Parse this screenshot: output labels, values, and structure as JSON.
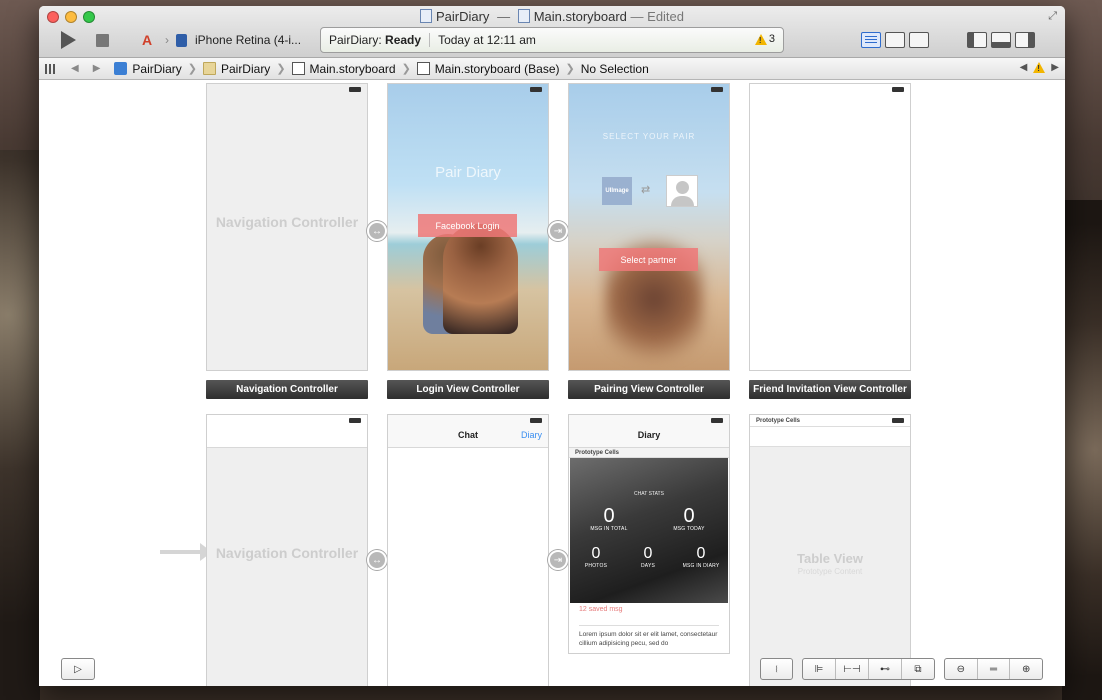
{
  "window": {
    "project": "PairDiary",
    "separator": "—",
    "file": "Main.storyboard",
    "edited": "— Edited"
  },
  "toolbar": {
    "scheme_name": "PairDiary",
    "device": "iPhone Retina (4-i...",
    "status_project": "PairDiary:",
    "status_state": "Ready",
    "status_time": "Today at 12:11 am",
    "warning_count": "3"
  },
  "jumpbar": {
    "crumbs": [
      "PairDiary",
      "PairDiary",
      "Main.storyboard",
      "Main.storyboard (Base)",
      "No Selection"
    ]
  },
  "scenes": {
    "nav1": {
      "ghost": "Navigation Controller",
      "caption": "Navigation Controller"
    },
    "login": {
      "title": "Pair Diary",
      "button": "Facebook Login",
      "caption": "Login View Controller"
    },
    "pairing": {
      "heading": "SELECT YOUR PAIR",
      "uiimage": "UIImage",
      "button": "Select partner",
      "caption": "Pairing View Controller"
    },
    "friend": {
      "caption": "Friend Invitation View Controller"
    },
    "nav2": {
      "ghost": "Navigation Controller"
    },
    "chat": {
      "title": "Chat",
      "link": "Diary"
    },
    "diary": {
      "title": "Diary",
      "proto": "Prototype Cells",
      "stats_title": "CHAT STATS",
      "stats": [
        {
          "n": "0",
          "l": "MSG IN TOTAL"
        },
        {
          "n": "0",
          "l": "MSG TODAY"
        },
        {
          "n": "0",
          "l": "PHOTOS"
        },
        {
          "n": "0",
          "l": "DAYS"
        },
        {
          "n": "0",
          "l": "MSG IN DIARY"
        }
      ],
      "saved": "12 saved msg",
      "lorem": "Lorem ipsum dolor sit er elit lamet, consectetaur cillium adipisicing pecu, sed do"
    },
    "table": {
      "proto": "Prototype Cells",
      "title": "Table View",
      "subtitle": "Prototype Content"
    }
  }
}
